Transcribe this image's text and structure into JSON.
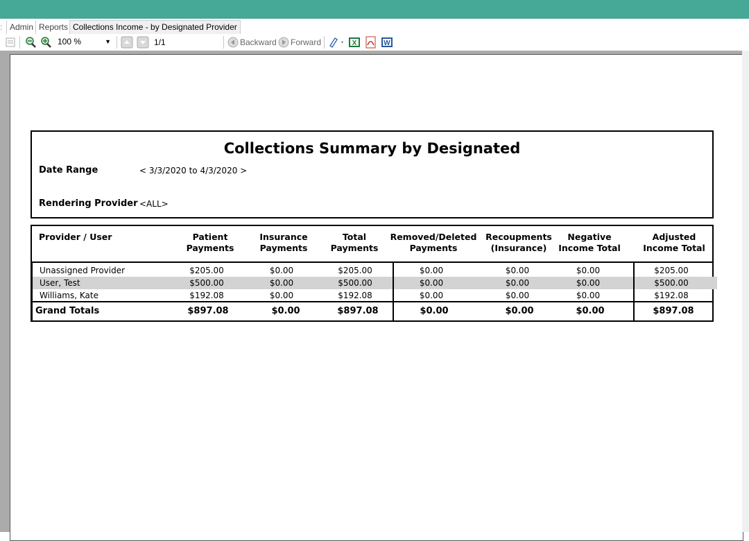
{
  "tabs": [
    "Admin",
    "Reports",
    "Collections Income - by Designated Provider"
  ],
  "toolbar": {
    "zoom": "100 %",
    "page": "1/1",
    "backward": "Backward",
    "forward": "Forward",
    "icons": [
      "print-icon",
      "zoom-out-icon",
      "zoom-in-icon",
      "prev-page-icon",
      "next-page-icon",
      "backward-icon",
      "forward-icon",
      "export-icon",
      "excel-icon",
      "pdf-icon",
      "word-icon"
    ]
  },
  "report": {
    "title": "Collections Summary by Designated",
    "date_range_label": "Date Range",
    "date_range_value": "< 3/3/2020 to 4/3/2020 >",
    "rendering_provider_label": "Rendering Provider",
    "rendering_provider_value": "<ALL>",
    "columns": [
      "Provider / User",
      "Patient Payments",
      "Insurance Payments",
      "Total Payments",
      "Removed/Deleted Payments",
      "Recoupments (Insurance)",
      "Negative Income Total",
      "Adjusted Income Total"
    ],
    "rows": [
      [
        "Unassigned Provider",
        "$205.00",
        "$0.00",
        "$205.00",
        "$0.00",
        "$0.00",
        "$0.00",
        "$205.00"
      ],
      [
        "User, Test",
        "$500.00",
        "$0.00",
        "$500.00",
        "$0.00",
        "$0.00",
        "$0.00",
        "$500.00"
      ],
      [
        "Williams, Kate",
        "$192.08",
        "$0.00",
        "$192.08",
        "$0.00",
        "$0.00",
        "$0.00",
        "$192.08"
      ]
    ],
    "totals": [
      "Grand Totals",
      "$897.08",
      "$0.00",
      "$897.08",
      "$0.00",
      "$0.00",
      "$0.00",
      "$897.08"
    ]
  },
  "colors": {
    "title_bar": "#46a896",
    "highlight_row": "#d3d3d3",
    "viewer_bg": "#ababab"
  }
}
